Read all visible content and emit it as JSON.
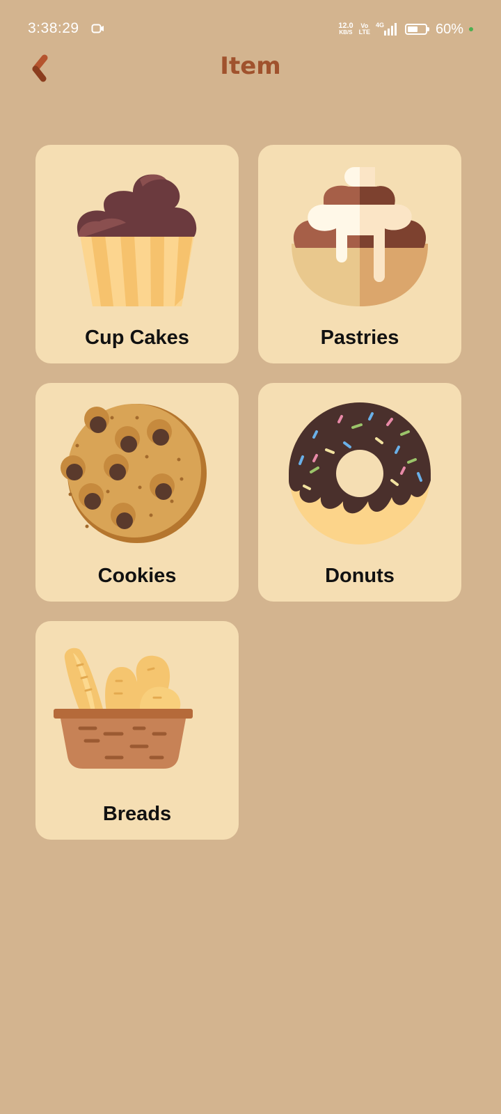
{
  "status_bar": {
    "time": "3:38:29",
    "net_speed_value": "12.0",
    "net_speed_unit": "KB/S",
    "volte_top": "Vo",
    "volte_bottom": "LTE",
    "network_type": "4G",
    "battery_percent": "60%",
    "battery_level": 0.6
  },
  "header": {
    "title": "Item",
    "back_icon": "chevron-left-icon"
  },
  "categories": [
    {
      "label": "Cup Cakes",
      "icon": "cupcake-icon"
    },
    {
      "label": "Pastries",
      "icon": "pastry-icon"
    },
    {
      "label": "Cookies",
      "icon": "cookie-icon"
    },
    {
      "label": "Donuts",
      "icon": "donut-icon"
    },
    {
      "label": "Breads",
      "icon": "bread-basket-icon"
    }
  ],
  "colors": {
    "background": "#d3b48f",
    "card": "#f5deb3",
    "title": "#a0522d"
  }
}
